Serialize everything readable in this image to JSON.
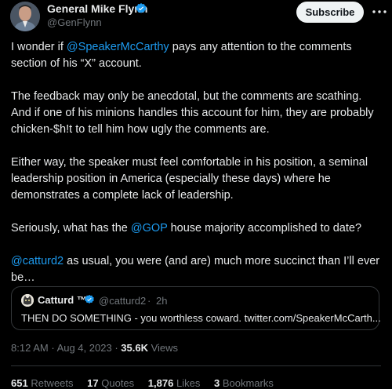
{
  "author": {
    "name": "General Mike Flynn",
    "handle": "@GenFlynn",
    "verified": true
  },
  "subscribe_label": "Subscribe",
  "tweet": {
    "p1_prefix": "I wonder if ",
    "p1_mention": "@SpeakerMcCarthy",
    "p1_suffix": " pays any attention to the comments section of his “X” account.",
    "p2": "The feedback may only be anecdotal, but the comments are scathing. And if one of his minions handles this account for him, they are probably chicken-$h!t to tell him how ugly the comments are.",
    "p3": "Either way, the speaker must feel comfortable in his position, a seminal leadership position in America (especially these days) where he demonstrates a complete lack of leadership.",
    "p4_prefix": "Seriously, what has the ",
    "p4_mention": "@GOP",
    "p4_suffix": " house majority accomplished to date?",
    "p5_mention": "@catturd2",
    "p5_suffix": " as usual, you were (and are) much more succinct than I’ll ever be…"
  },
  "quote": {
    "name": "Catturd ™",
    "handle": "@catturd2",
    "separator": "·",
    "time": "2h",
    "text": "THEN DO SOMETHING - you worthless coward. twitter.com/SpeakerMcCarth..."
  },
  "meta": {
    "time": "8:12 AM",
    "date": "Aug 4, 2023",
    "views_count": "35.6K",
    "views_label": "Views"
  },
  "stats": {
    "retweets_count": "651",
    "retweets_label": "Retweets",
    "quotes_count": "17",
    "quotes_label": "Quotes",
    "likes_count": "1,876",
    "likes_label": "Likes",
    "bookmarks_count": "3",
    "bookmarks_label": "Bookmarks"
  },
  "colors": {
    "background": "#000000",
    "text": "#e7e9ea",
    "muted": "#71767b",
    "link": "#1d9bf0",
    "verified": "#1d9bf0"
  }
}
